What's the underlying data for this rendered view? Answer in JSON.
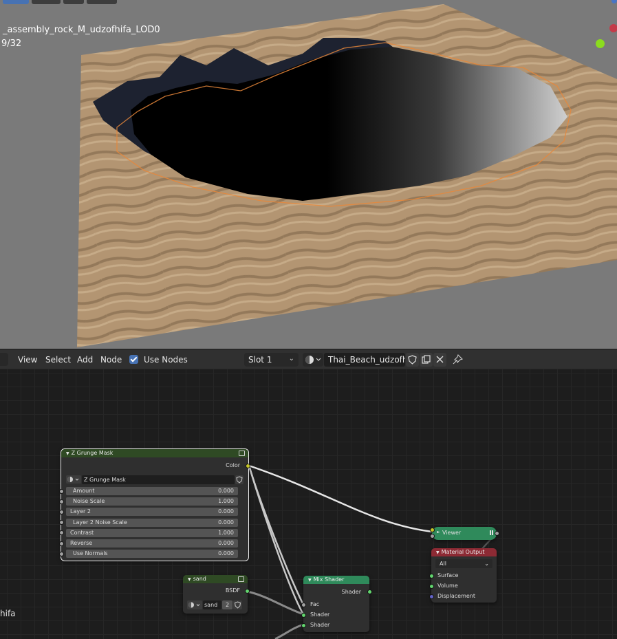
{
  "viewport": {
    "object_name": "_assembly_rock_M_udzofhifa_LOD0",
    "frame_counter": "9/32"
  },
  "header": {
    "menus": [
      "View",
      "Select",
      "Add",
      "Node"
    ],
    "use_nodes_label": "Use Nodes",
    "use_nodes_checked": true,
    "slot_value": "Slot 1",
    "material_name": "Thai_Beach_udzofhifa"
  },
  "canvas": {
    "left_edge_text": "hifa"
  },
  "nodes": {
    "z_grunge": {
      "title": "Z Grunge Mask",
      "output_label": "Color",
      "group_name": "Z Grunge Mask",
      "inputs": [
        {
          "label": "Amount",
          "value": "0.000"
        },
        {
          "label": "Noise Scale",
          "value": "1.000"
        },
        {
          "label": "Layer 2",
          "value": "0.000"
        },
        {
          "label": "Layer 2 Noise Scale",
          "value": "0.000"
        },
        {
          "label": "Contrast",
          "value": "1.000"
        },
        {
          "label": "Reverse",
          "value": "0.000"
        },
        {
          "label": "Use Normals",
          "value": "0.000"
        }
      ]
    },
    "sand": {
      "title": "sand",
      "output_label": "BSDF",
      "group_name": "sand",
      "user_count": "2"
    },
    "mix_shader": {
      "title": "Mix Shader",
      "output_label": "Shader",
      "inputs": [
        "Fac",
        "Shader",
        "Shader"
      ]
    },
    "viewer": {
      "title": "Viewer"
    },
    "material_output": {
      "title": "Material Output",
      "target": "All",
      "inputs": [
        "Surface",
        "Volume",
        "Displacement"
      ]
    }
  },
  "colors": {
    "group_header": "#2f4a24",
    "shader_header": "#2f8a5b",
    "output_header": "#8d2a34",
    "viewer_header": "#2f8a5b",
    "selection_outline": "#e8873a"
  }
}
